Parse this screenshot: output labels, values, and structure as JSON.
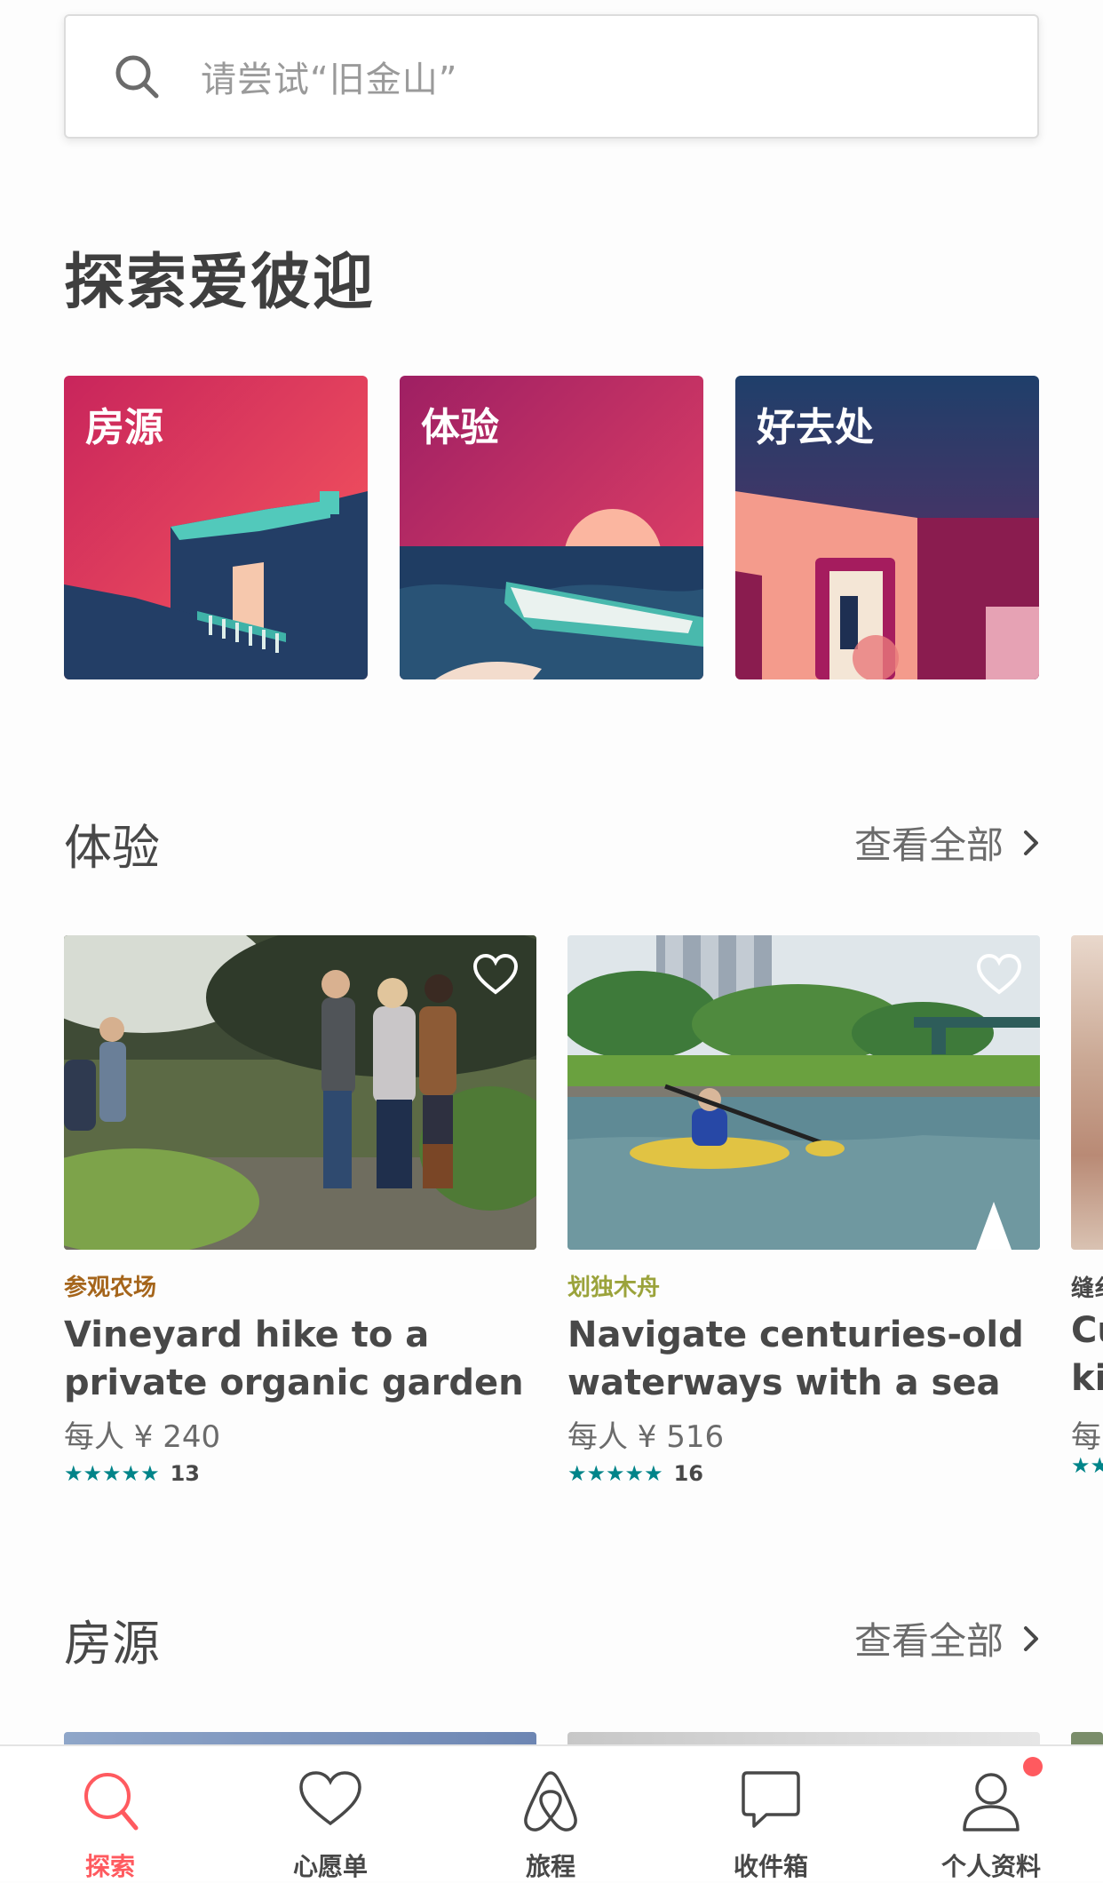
{
  "search": {
    "placeholder": "请尝试“旧金山”"
  },
  "page_title": "探索爱彼迎",
  "categories": [
    {
      "label": "房源"
    },
    {
      "label": "体验"
    },
    {
      "label": "好去处"
    }
  ],
  "experiences_section": {
    "title": "体验",
    "see_all": "查看全部",
    "cards": [
      {
        "kind": "参观农场",
        "kind_color": "#a5651b",
        "title": "Vineyard hike to a private organic garden & Wine…",
        "price": "每人 ¥ 240",
        "stars": "★★★★★",
        "reviews": "13"
      },
      {
        "kind": "划独木舟",
        "kind_color": "#9ba33b",
        "title": "Navigate centuries-old waterways with a sea k…",
        "price": "每人 ¥ 516",
        "stars": "★★★★★",
        "reviews": "16"
      }
    ],
    "peek_card": {
      "kind": "缝纟",
      "title": "Cu",
      "title2": "ki",
      "price": "每",
      "stars": "★★"
    }
  },
  "listings_section": {
    "title": "房源",
    "see_all": "查看全部"
  },
  "tab_bar": {
    "active_color": "#ff5a5f",
    "tabs": [
      {
        "label": "探索",
        "icon": "search-icon",
        "active": true
      },
      {
        "label": "心愿单",
        "icon": "heart-icon"
      },
      {
        "label": "旅程",
        "icon": "airbnb-logo-icon"
      },
      {
        "label": "收件箱",
        "icon": "message-icon"
      },
      {
        "label": "个人资料",
        "icon": "profile-icon",
        "has_notification": true
      }
    ]
  },
  "colors": {
    "accent": "#ff5a5f",
    "teal": "#008489",
    "text": "#484848"
  }
}
